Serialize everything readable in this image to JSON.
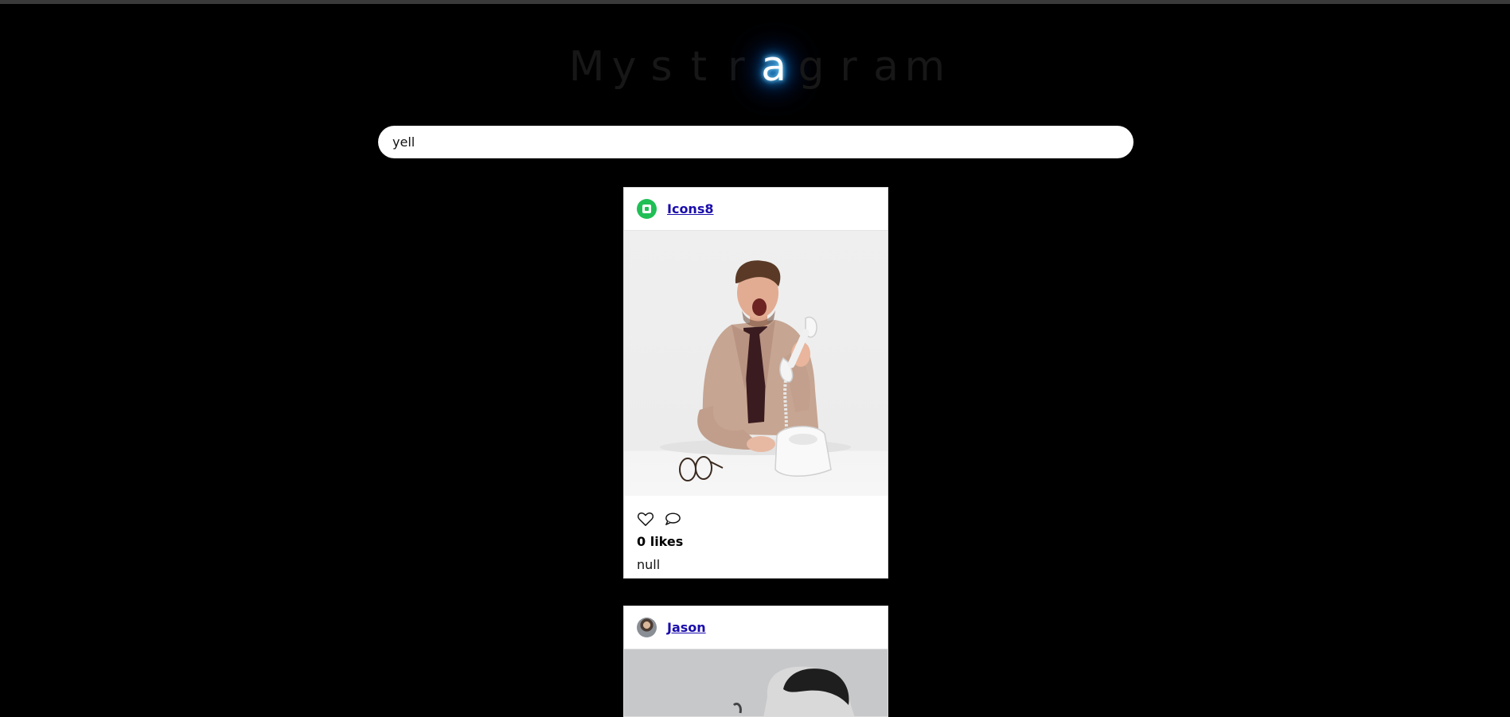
{
  "app": {
    "logo_letters": [
      "M",
      "y",
      "s",
      "t",
      "r",
      "a",
      "g",
      "r",
      "a",
      "m"
    ],
    "logo_glow_index": 5,
    "accent_glow_color": "#0a8fff"
  },
  "search": {
    "value": "yell",
    "icon": "none"
  },
  "posts": [
    {
      "username": "Icons8",
      "avatar": "icons8-logo-icon",
      "likes_text": "0 likes",
      "caption": "null",
      "image": "man yelling into telephone handset"
    },
    {
      "username": "Jason",
      "avatar": "user-photo-avatar",
      "image": "man in grayscale portrait"
    }
  ],
  "icons": {
    "like": "heart-icon",
    "comment": "comment-icon"
  }
}
